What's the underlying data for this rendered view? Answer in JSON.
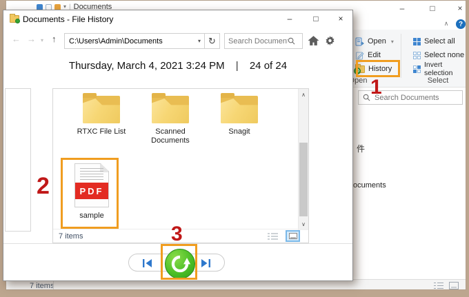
{
  "explorer": {
    "qat_title": "Documents",
    "ribbon": {
      "open_label": "Open",
      "edit_label": "Edit",
      "history_label": "History",
      "select_all_label": "Select all",
      "select_none_label": "Select none",
      "invert_selection_label": "Invert selection",
      "open_group_label": "Open",
      "select_group_label": "Select"
    },
    "search_placeholder": "Search Documents",
    "partial_text_1": "件",
    "partial_text_2": "ocuments",
    "status_items_count": "7 items",
    "help_label": "?"
  },
  "dialog": {
    "window_title": "Documents - File History",
    "address_value": "C:\\Users\\Admin\\Documents",
    "search_placeholder": "Search Documents",
    "date_heading": "Thursday, March 4, 2021 3:24 PM",
    "heading_separator": "|",
    "version_position": "24 of 24",
    "items": [
      {
        "name": "RTXC File List",
        "type": "folder"
      },
      {
        "name": "Scanned Documents",
        "type": "folder"
      },
      {
        "name": "Snagit",
        "type": "folder"
      },
      {
        "name": "sample",
        "type": "pdf"
      }
    ],
    "pdf_badge": "PDF",
    "status_items_count": "7 items"
  },
  "icons": {
    "minimize": "–",
    "maximize": "□",
    "close": "×",
    "back": "←",
    "forward": "→",
    "up": "↑",
    "dropdown": "▾",
    "refresh": "↻",
    "collapse": "∧",
    "scroll_up": "∧",
    "scroll_down": "∨",
    "qat_separator": "|"
  },
  "annotations": {
    "step1": "1",
    "step2": "2",
    "step3": "3",
    "highlight_color": "#F09D20",
    "number_color": "#C01818"
  },
  "colors": {
    "desktop": "#BDA68F",
    "pdf_red": "#E32B22",
    "restore_green": "#3FAE29",
    "folder_yellow": "#F7D775",
    "accent_blue": "#2E78CC"
  }
}
